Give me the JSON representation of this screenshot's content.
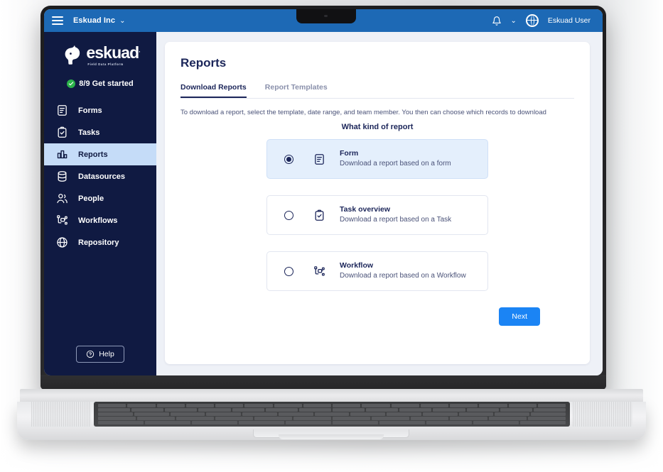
{
  "topbar": {
    "menu_icon": "hamburger-icon",
    "org_name": "Eskuad Inc",
    "org_caret": "⌄",
    "bell_icon": "bell-icon",
    "user_caret": "⌄",
    "avatar_icon": "globe-avatar-icon",
    "user_name": "Eskuad User"
  },
  "sidebar": {
    "logo_word": "eskuad",
    "logo_registered": ".",
    "logo_tagline": "Field Data Platform",
    "onboarding": {
      "label": "8/9 Get started",
      "check_icon": "check-circle-icon",
      "accent": "#2bb34a"
    },
    "items": [
      {
        "label": "Forms",
        "icon": "document-icon",
        "active": false
      },
      {
        "label": "Tasks",
        "icon": "clipboard-check-icon",
        "active": false
      },
      {
        "label": "Reports",
        "icon": "bar-chart-icon",
        "active": true
      },
      {
        "label": "Datasources",
        "icon": "database-icon",
        "active": false
      },
      {
        "label": "People",
        "icon": "people-icon",
        "active": false
      },
      {
        "label": "Workflows",
        "icon": "workflow-icon",
        "active": false
      },
      {
        "label": "Repository",
        "icon": "globe-icon",
        "active": false
      }
    ],
    "help": {
      "label": "Help",
      "icon": "question-circle-icon"
    },
    "active_bg": "#c5dcf8",
    "bg": "#101a42"
  },
  "main": {
    "page_title": "Reports",
    "tabs": [
      {
        "label": "Download Reports",
        "active": true
      },
      {
        "label": "Report Templates",
        "active": false
      }
    ],
    "description": "To download a report, select the template, date range, and team member. You then can choose which records to download",
    "section_title": "What kind of report",
    "options": [
      {
        "title": "Form",
        "subtitle": "Download a report based on a form",
        "icon": "document-icon",
        "selected": true
      },
      {
        "title": "Task overview",
        "subtitle": "Download a report based on a Task",
        "icon": "clipboard-check-icon",
        "selected": false
      },
      {
        "title": "Workflow",
        "subtitle": "Download a report based on a Workflow",
        "icon": "workflow-icon",
        "selected": false
      }
    ],
    "next_label": "Next",
    "next_color": "#1b84f4"
  },
  "theme": {
    "topbar_blue": "#1d69b5",
    "navy": "#101a42",
    "text_navy": "#1b2559",
    "content_bg": "#eef1f7"
  }
}
